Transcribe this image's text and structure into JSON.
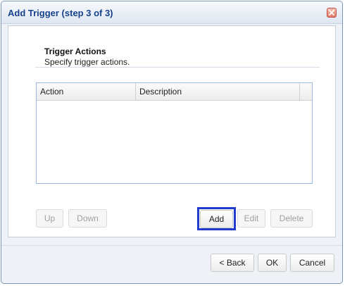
{
  "dialog": {
    "title": "Add Trigger (step 3 of 3)",
    "close_icon": "close-icon"
  },
  "section": {
    "title": "Trigger Actions",
    "subtitle": "Specify trigger actions."
  },
  "grid": {
    "columns": [
      "Action",
      "Description"
    ],
    "rows": []
  },
  "grid_buttons": {
    "up": "Up",
    "down": "Down",
    "add": "Add",
    "edit": "Edit",
    "delete": "Delete"
  },
  "footer_buttons": {
    "back": "< Back",
    "ok": "OK",
    "cancel": "Cancel"
  },
  "colors": {
    "title_text": "#15428b",
    "focus_ring": "#1f3ccc",
    "grid_border": "#99bbe8"
  }
}
